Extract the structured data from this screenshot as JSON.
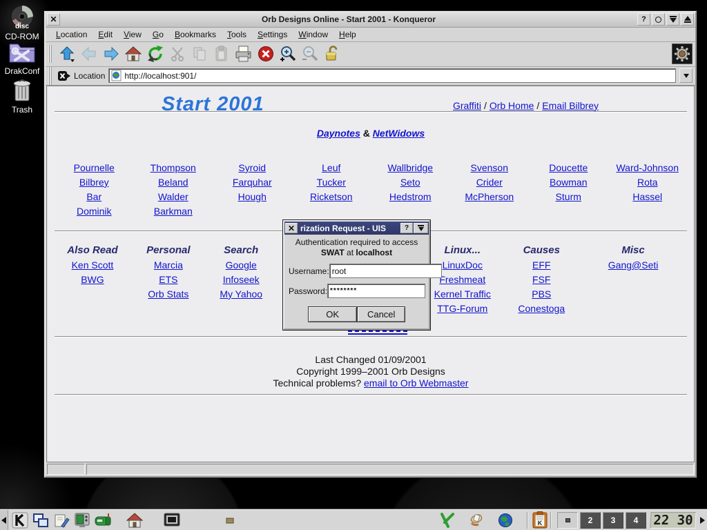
{
  "desktop": {
    "icons": [
      {
        "label": "CD-ROM",
        "badge": "disc"
      },
      {
        "label": "DrakConf"
      },
      {
        "label": "Trash"
      }
    ]
  },
  "window": {
    "title": "Orb Designs Online - Start 2001 - Konqueror",
    "menu": [
      "Location",
      "Edit",
      "View",
      "Go",
      "Bookmarks",
      "Tools",
      "Settings",
      "Window",
      "Help"
    ],
    "toolbar_icons": [
      "up",
      "back",
      "forward",
      "home",
      "reload",
      "cut",
      "copy",
      "paste",
      "print",
      "stop",
      "zoom-in",
      "zoom-out",
      "lock",
      "konqueror-gear"
    ],
    "location_label": "Location",
    "url": "http://localhost:901/"
  },
  "page": {
    "title": "Start 2001",
    "top_links": [
      "Graffiti",
      "Orb Home",
      "Email Bilbrey"
    ],
    "top_sep": "/",
    "daynotes_link1": "Daynotes",
    "daynotes_amp": "&",
    "daynotes_link2": "NetWidows",
    "names": [
      [
        "Pournelle",
        "Thompson",
        "Syroid",
        "Leuf",
        "Wallbridge",
        "Svenson",
        "Doucette",
        "Ward-Johnson"
      ],
      [
        "Bilbrey",
        "Beland",
        "Farquhar",
        "Tucker",
        "Seto",
        "Crider",
        "Bowman",
        "Rota"
      ],
      [
        "Bar",
        "Walder",
        "Hough",
        "Ricketson",
        "Hedstrom",
        "McPherson",
        "Sturm",
        "Hassel"
      ],
      [
        "Dominik",
        "Barkman"
      ]
    ],
    "sections": [
      {
        "header": "Also Read",
        "links": [
          "Ken Scott",
          "BWG"
        ]
      },
      {
        "header": "Personal",
        "links": [
          "Marcia",
          "ETS",
          "Orb Stats"
        ]
      },
      {
        "header": "Search",
        "links": [
          "Google",
          "Infoseek",
          "My Yahoo"
        ]
      },
      {
        "header": "",
        "links": []
      },
      {
        "header": "Linux...",
        "links": [
          "LinuxDoc",
          "Freshmeat",
          "Kernel Traffic",
          "TTG-Forum"
        ]
      },
      {
        "header": "Causes",
        "links": [
          "EFF",
          "FSF",
          "PBS",
          "Conestoga"
        ]
      },
      {
        "header": "Misc",
        "links": [
          "Gang@Seti"
        ]
      }
    ],
    "footer": {
      "line1": "Last Changed 01/09/2001",
      "line2": "Copyright 1999–2001 Orb Designs",
      "line3_prefix": "Technical problems? ",
      "line3_link": "email to Orb Webmaster"
    }
  },
  "dialog": {
    "title_visible": "rization Request - UIS",
    "message_line1": "Authentication required to access",
    "message_bold1": "SWAT",
    "message_mid": " at ",
    "message_bold2": "localhost",
    "username_label": "Username:",
    "username_value": "root",
    "password_label": "Password:",
    "password_value": "********",
    "ok_label": "OK",
    "cancel_label": "Cancel"
  },
  "taskbar": {
    "pager": [
      "2",
      "3",
      "4"
    ],
    "clock": "22 30"
  },
  "colors": {
    "accent_title": "#2d74d8",
    "link_blue": "#1212cc",
    "section_header": "#28286e",
    "dialog_titlebar": "#353f73",
    "stop_red": "#c42121"
  }
}
